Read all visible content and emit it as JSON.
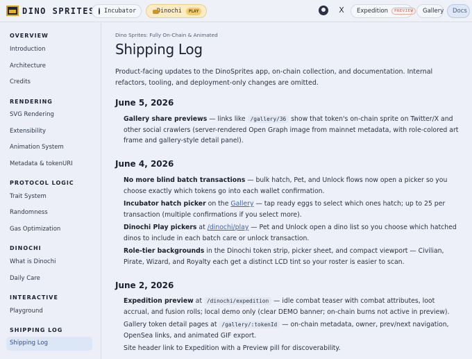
{
  "header": {
    "logo_text": "DINO SPRITES",
    "nav": {
      "incubator": "Incubator",
      "dinochi": "Dinochi",
      "dinochi_badge": "PLAY",
      "x_glyph": "X",
      "expedition": "Expedition",
      "expedition_badge": "PREVIEW",
      "gallery": "Gallery",
      "docs": "Docs"
    }
  },
  "sidebar": {
    "sections": [
      {
        "title": "OVERVIEW",
        "items": [
          "Introduction",
          "Architecture",
          "Credits"
        ]
      },
      {
        "title": "RENDERING",
        "items": [
          "SVG Rendering",
          "Extensibility",
          "Animation System",
          "Metadata & tokenURI"
        ]
      },
      {
        "title": "PROTOCOL LOGIC",
        "items": [
          "Trait System",
          "Randomness",
          "Gas Optimization"
        ]
      },
      {
        "title": "DINOCHI",
        "items": [
          "What is Dinochi",
          "Daily Care"
        ]
      },
      {
        "title": "INTERACTIVE",
        "items": [
          "Playground"
        ]
      },
      {
        "title": "SHIPPING LOG",
        "items": [
          "Shipping Log"
        ]
      }
    ],
    "active_item": "Shipping Log"
  },
  "main": {
    "kicker": "Dino Sprites: Fully On-Chain & Animated",
    "title": "Shipping Log",
    "intro": "Product-facing updates to the DinoSprites app, on-chain collection, and documentation. Internal refactors, tooling, and deployment-only changes are omitted.",
    "dates": [
      "June 5, 2026",
      "June 4, 2026",
      "June 2, 2026"
    ],
    "entries": {
      "e1": {
        "title": "Gallery share previews",
        "t1": " — links like ",
        "code": "/gallery/36",
        "t2": " show that token's on-chain sprite on Twitter/X and other social crawlers (server-rendered Open Graph image from mainnet metadata, with role-colored art frame and gallery-style detail panel)."
      },
      "e2": {
        "title": "No more blind batch transactions",
        "t1": " — bulk hatch, Pet, and Unlock flows now open a picker so you choose exactly which tokens go into each wallet confirmation."
      },
      "e3": {
        "title": "Incubator hatch picker",
        "t1": " on the ",
        "link": "Gallery",
        "t2": " — tap ready eggs to select which ones hatch; up to 25 per transaction (multiple confirmations if you select more)."
      },
      "e4": {
        "title": "Dinochi Play pickers",
        "t1": " at ",
        "link": "/dinochi/play",
        "t2": " — Pet and Unlock open a dino list so you choose which hatched dinos to include in each batch care or unlock transaction."
      },
      "e5": {
        "title": "Role-tier backgrounds",
        "t1": " in the Dinochi token strip, picker sheet, and compact viewport — Civilian, Pirate, Wizard, and Royalty each get a distinct LCD tint so your roster is easier to scan."
      },
      "e6": {
        "title": "Expedition preview",
        "t1": " at ",
        "code": "/dinochi/expedition",
        "t2": " — idle combat teaser with combat attributes, loot accrual, and fusion rolls; local demo only (clear DEMO banner; on-chain burns not active in preview)."
      },
      "e7": {
        "t1": "Gallery token detail pages at ",
        "code": "/gallery/:tokenId",
        "t2": " — on-chain metadata, owner, prev/next navigation, OpenSea links, and animated GIF export."
      },
      "e8": {
        "t1": "Site header link to Expedition with a Preview pill for discoverability."
      }
    }
  }
}
